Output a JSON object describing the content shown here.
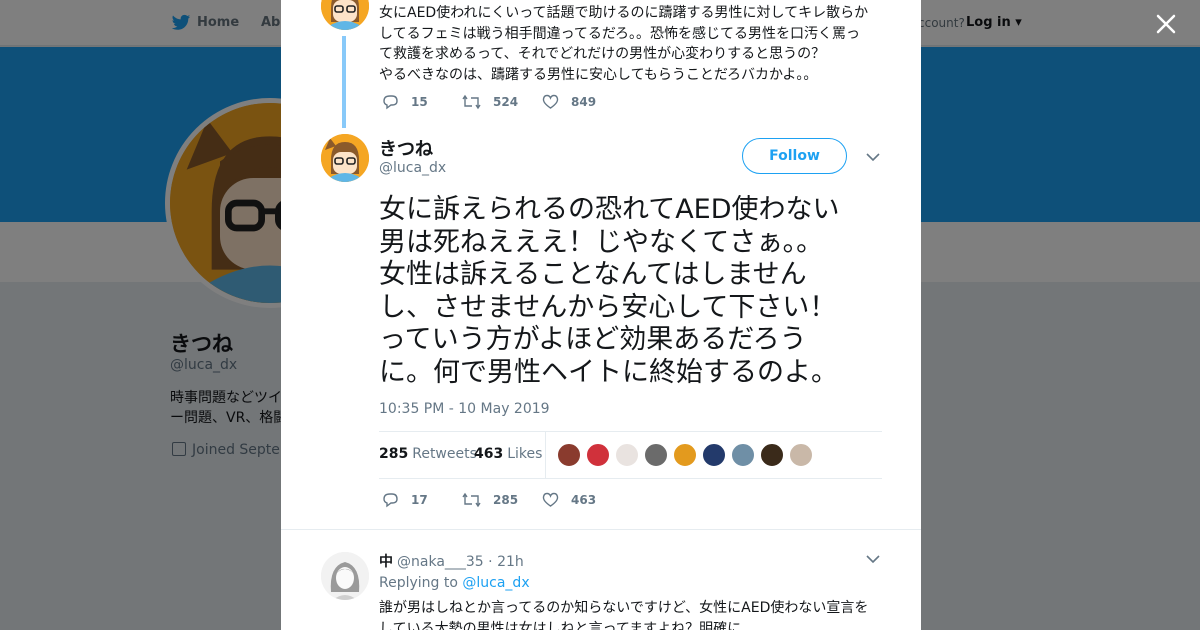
{
  "background": {
    "nav": {
      "home_label": "Home",
      "about_label": "Abo",
      "have_account_text": "ccount?",
      "login_label": "Log in"
    },
    "profile": {
      "name": "きつね",
      "handle": "@luca_dx",
      "bio_line1": "時事問題などツイ",
      "bio_line2": "ー問題、VR、格闘",
      "joined_text": "Joined Septem"
    }
  },
  "previous_tweet": {
    "text_lines": [
      "女にAED使われにくいって話題で助けるのに躊躇する男性に対してキレ散らか",
      "してるフェミは戦う相手間違ってるだろ。。恐怖を感じてる男性を口汚く罵っ",
      "て救護を求めるって、それでどれだけの男性が心変わりすると思うの？",
      "やるべきなのは、躊躇する男性に安心してもらうことだろバカかよ。。"
    ],
    "replies": "15",
    "retweets": "524",
    "likes": "849"
  },
  "main_tweet": {
    "name": "きつね",
    "handle": "@luca_dx",
    "follow_label": "Follow",
    "text_lines": [
      "女に訴えられるの恐れてAED使わない",
      "男は死ねえええ！じやなくてさぁ。。",
      "女性は訴えることなんてはしません",
      "し、させませんから安心して下さい！",
      "っていう方がよほど効果あるだろう",
      "に。何で男性ヘイトに終始するのよ。"
    ],
    "timestamp": "10:35 PM - 10 May 2019",
    "retweets_count": "285",
    "retweets_label": "Retweets",
    "likes_count": "463",
    "likes_label": "Likes",
    "likers": [
      "#8a3b2e",
      "#d0313b",
      "#e9e3e0",
      "#6b6b6b",
      "#e39a1e",
      "#233a6b",
      "#6f8fa6",
      "#3a2a1a",
      "#c9b8a8"
    ],
    "actions": {
      "replies": "17",
      "retweets": "285",
      "likes": "463"
    }
  },
  "reply_tweet": {
    "name": "中",
    "handle": "@naka___35",
    "time": "· 21h",
    "replying_to_label": "Replying to",
    "replying_to_handle": "@luca_dx",
    "text_lines": [
      "誰が男はしねとか言ってるのか知らないですけど、女性にAED使わない宣言を",
      "している大勢の男性は女はしねと言ってますよね？明確に"
    ]
  },
  "colors": {
    "accent": "#1da1f2",
    "thread_line": "#88c9f9",
    "text_primary": "#14171a",
    "text_secondary": "#657786",
    "avatar_bg": "#f5a623"
  },
  "icons": [
    "twitter-bird-icon",
    "close-icon",
    "reply-icon",
    "retweet-icon",
    "like-icon",
    "chevron-down-icon",
    "calendar-icon"
  ]
}
